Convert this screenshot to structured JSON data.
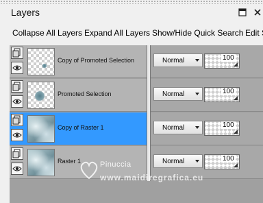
{
  "panel": {
    "title": "Layers",
    "menu_icon": "panel-menu-icon",
    "close_icon": "close-icon"
  },
  "toolbar": {
    "items": [
      {
        "label": "Collapse All Layers"
      },
      {
        "label": "Expand All Layers"
      },
      {
        "label": "Show/Hide Quick Search"
      },
      {
        "label": "Edit S"
      }
    ]
  },
  "layers": [
    {
      "name": "Copy of Promoted Selection",
      "blend_mode": "Normal",
      "opacity": "100",
      "selected": false,
      "thumbnail": "transparent-with-fragment"
    },
    {
      "name": "Promoted Selection",
      "blend_mode": "Normal",
      "opacity": "100",
      "selected": false,
      "thumbnail": "transparent-with-fragment"
    },
    {
      "name": "Copy of Raster 1",
      "blend_mode": "Normal",
      "opacity": "100",
      "selected": true,
      "thumbnail": "image"
    },
    {
      "name": "Raster 1",
      "blend_mode": "Normal",
      "opacity": "100",
      "selected": false,
      "thumbnail": "image"
    }
  ],
  "watermark": {
    "name": "Pinuccia",
    "url": "www.maidiregrafica.eu"
  },
  "colors": {
    "selected_row": "#3399ff",
    "row_bg": "#b4b4b4",
    "panel_bg": "#f0f0f0"
  }
}
